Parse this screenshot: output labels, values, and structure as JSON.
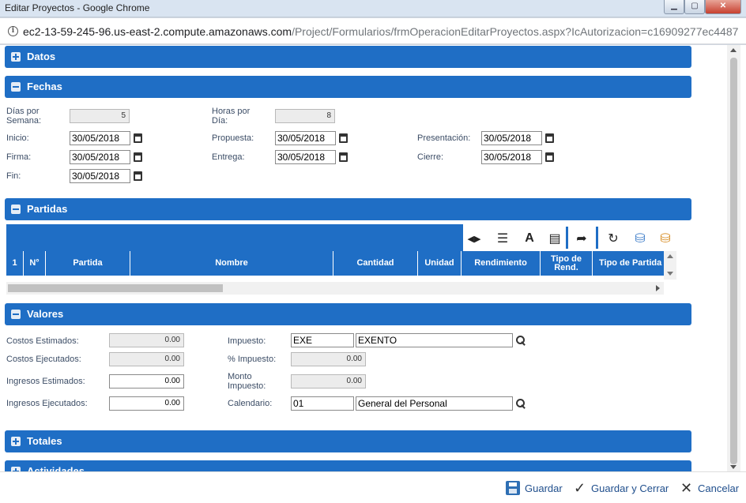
{
  "window": {
    "title": "Editar Proyectos - Google Chrome",
    "min_glyph": "▁",
    "max_glyph": "▢",
    "close_glyph": "✕"
  },
  "address_bar": {
    "host": "ec2-13-59-245-96.us-east-2.compute.amazonaws.com",
    "path": "/Project/Formularios/frmOperacionEditarProyectos.aspx?IcAutorizacion=c16909277ec4487..."
  },
  "sections": {
    "datos": "Datos",
    "fechas": "Fechas",
    "partidas": "Partidas",
    "valores": "Valores",
    "totales": "Totales",
    "actividades": "Actividades"
  },
  "fechas": {
    "dias_por_semana_label": "Días por Semana:",
    "dias_por_semana": "5",
    "horas_por_dia_label": "Horas por Día:",
    "horas_por_dia": "8",
    "inicio_label": "Inicio:",
    "inicio": "30/05/2018",
    "propuesta_label": "Propuesta:",
    "propuesta": "30/05/2018",
    "presentacion_label": "Presentación:",
    "presentacion": "30/05/2018",
    "firma_label": "Firma:",
    "firma": "30/05/2018",
    "entrega_label": "Entrega:",
    "entrega": "30/05/2018",
    "cierre_label": "Cierre:",
    "cierre": "30/05/2018",
    "fin_label": "Fin:",
    "fin": "30/05/2018"
  },
  "partidas_grid": {
    "columns": [
      "1",
      "N°",
      "Partida",
      "Nombre",
      "Cantidad",
      "Unidad",
      "Rendimiento",
      "Tipo de Rend.",
      "Tipo de Partida"
    ],
    "toolbar_icons": [
      "move-arrows-icon",
      "list-icon",
      "text-icon",
      "document-icon",
      "forward-icon",
      "refresh-icon",
      "database-add-icon",
      "database-remove-icon"
    ]
  },
  "valores": {
    "costos_estimados_label": "Costos Estimados:",
    "costos_estimados": "0.00",
    "costos_ejecutados_label": "Costos Ejecutados:",
    "costos_ejecutados": "0.00",
    "ingresos_estimados_label": "Ingresos Estimados:",
    "ingresos_estimados": "0.00",
    "ingresos_ejecutados_label": "Ingresos Ejecutados:",
    "ingresos_ejecutados": "0.00",
    "impuesto_label": "Impuesto:",
    "impuesto_codigo": "EXE",
    "impuesto_nombre": "EXENTO",
    "pct_impuesto_label": "% Impuesto:",
    "pct_impuesto": "0.00",
    "monto_impuesto_label": "Monto Impuesto:",
    "monto_impuesto": "0.00",
    "calendario_label": "Calendario:",
    "calendario_codigo": "01",
    "calendario_nombre": "General del Personal"
  },
  "footer": {
    "guardar": "Guardar",
    "guardar_cerrar": "Guardar y Cerrar",
    "cancelar": "Cancelar"
  },
  "colors": {
    "accent": "#1f6ec5",
    "label_text": "#3c4d66"
  }
}
